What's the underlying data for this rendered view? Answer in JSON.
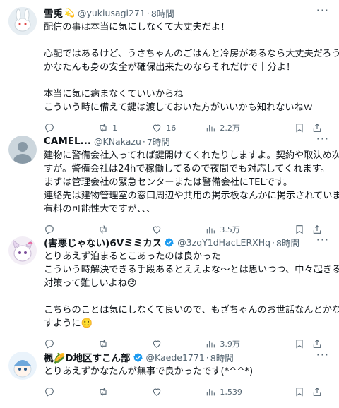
{
  "tweets": [
    {
      "name": "雪兎",
      "badge": "💫",
      "handle": "@yukiusagi271",
      "time": "8時間",
      "lines": [
        "配信の事は本当に気にしなくて大丈夫だよ！",
        "",
        "心配ではあるけど、うさちゃんのごはんと冷房があるなら大丈夫だろうし、",
        "かなたんも身の安全が確保出来たのならそれだけで十分よ！",
        "",
        "本当に気に病まなくていいからね",
        "こういう時に備えて鍵は渡しておいた方がいいかも知れないねｗ"
      ],
      "replies": "",
      "reposts": "1",
      "likes": "16",
      "views": "2.2万"
    },
    {
      "name": "CAMEL...",
      "badge": "",
      "handle": "@KNakazu",
      "time": "7時間",
      "lines": [
        "建物に警備会社入ってれば鍵開けてくれたりしますよ。契約や取決め次第で",
        "すが。警備会社は24hで稼働してるので夜間でも対応してくれます。",
        "まずは管理会社の緊急センターまたは警備会社にTELです。",
        "連絡先は建物管理室の窓口周辺や共用の掲示板なんかに掲示されています。",
        "有料の可能性大ですが、、、"
      ],
      "replies": "",
      "reposts": "",
      "likes": "",
      "views": "3.5万"
    },
    {
      "name": "(害悪じゃない)6Vミミカス",
      "badge": "",
      "handle": "@3zqY1dHacLERXHq",
      "time": "8時間",
      "lines": [
        "とりあえず泊まるとこあったのは良かった",
        "こういう時解決できる手段あるとええよな〜とは思いつつ、中々起きる前に",
        "対策って難しいよね😢",
        "",
        "こちらのことは気にしなくて良いので、もざちゃんのお世話なんとかなりま",
        "すように🙂"
      ],
      "replies": "",
      "reposts": "",
      "likes": "",
      "views": "3.9万"
    },
    {
      "name": "楓🌽D地区すこん部",
      "badge": "",
      "handle": "@Kaede1771",
      "time": "8時間",
      "lines": [
        "とりあえずかなたんが無事で良かったです(*^^*)"
      ],
      "replies": "",
      "reposts": "",
      "likes": "",
      "views": "1,539"
    }
  ],
  "colors": {
    "text": "#0f1419",
    "secondary": "#536471",
    "verified": "#1d9bf0",
    "divider": "#eff3f4"
  },
  "icons": [
    "reply-icon",
    "repost-icon",
    "like-icon",
    "views-icon",
    "bookmark-icon",
    "share-icon",
    "more-icon",
    "verified-icon"
  ]
}
